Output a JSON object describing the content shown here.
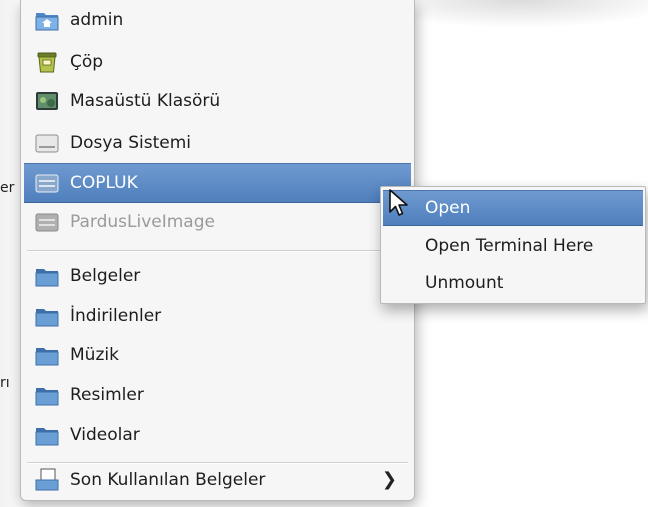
{
  "edge_text": {
    "er": "er",
    "ri": "rı"
  },
  "menu": {
    "items": [
      {
        "label": "admin",
        "icon": "home-folder-icon"
      },
      {
        "label": "Çöp",
        "icon": "trash-icon"
      },
      {
        "label": "Masaüstü Klasörü",
        "icon": "desktop-icon"
      },
      {
        "label": "Dosya Sistemi",
        "icon": "drive-icon"
      },
      {
        "label": "COPLUK",
        "icon": "drive-icon",
        "state": "highlighted"
      },
      {
        "label": "PardusLiveImage",
        "icon": "drive-icon",
        "state": "disabled"
      },
      {
        "label": "Belgeler",
        "icon": "folder-icon"
      },
      {
        "label": "İndirilenler",
        "icon": "folder-icon"
      },
      {
        "label": "Müzik",
        "icon": "folder-icon"
      },
      {
        "label": "Resimler",
        "icon": "folder-icon"
      },
      {
        "label": "Videolar",
        "icon": "folder-icon"
      },
      {
        "label": "Son Kullanılan Belgeler",
        "icon": "recent-documents-icon",
        "arrow": "❯"
      }
    ]
  },
  "submenu": {
    "items": [
      {
        "label": "Open",
        "state": "highlighted"
      },
      {
        "label": "Open Terminal Here"
      },
      {
        "label": "Unmount"
      }
    ]
  },
  "colors": {
    "highlight": "#5a88c6",
    "folder": "#6a9fd6",
    "menu_bg": "#f6f6f6"
  }
}
